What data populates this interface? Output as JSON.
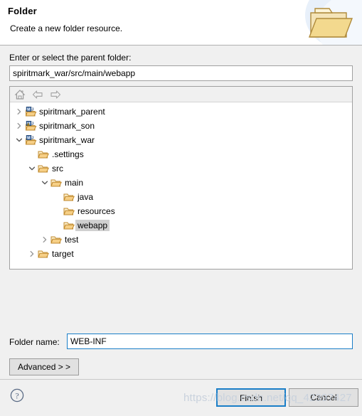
{
  "header": {
    "title": "Folder",
    "description": "Create a new folder resource.",
    "banner_icon": "open-folder-icon"
  },
  "form": {
    "parent_label": "Enter or select the parent folder:",
    "parent_value": "spiritmark_war/src/main/webapp",
    "parent_placeholder": "",
    "folder_name_label": "Folder name:",
    "folder_name_value": "WEB-INF",
    "folder_name_placeholder": "",
    "advanced_label": "Advanced  > >"
  },
  "tree_toolbar": {
    "home_icon": "home-icon",
    "back_icon": "back-arrow-icon",
    "forward_icon": "forward-arrow-icon"
  },
  "tree": {
    "items": [
      {
        "label": "spiritmark_parent",
        "indent": 0,
        "twisty": "collapsed",
        "icon": "maven-project-icon",
        "selected": false,
        "warning": false
      },
      {
        "label": "spiritmark_son",
        "indent": 0,
        "twisty": "collapsed",
        "icon": "maven-project-icon",
        "selected": false,
        "warning": true
      },
      {
        "label": "spiritmark_war",
        "indent": 0,
        "twisty": "expanded",
        "icon": "maven-project-icon",
        "selected": false,
        "warning": false
      },
      {
        "label": ".settings",
        "indent": 1,
        "twisty": "none",
        "icon": "folder-icon",
        "selected": false,
        "warning": false
      },
      {
        "label": "src",
        "indent": 1,
        "twisty": "expanded",
        "icon": "folder-icon",
        "selected": false,
        "warning": false
      },
      {
        "label": "main",
        "indent": 2,
        "twisty": "expanded",
        "icon": "folder-icon",
        "selected": false,
        "warning": false
      },
      {
        "label": "java",
        "indent": 3,
        "twisty": "none",
        "icon": "folder-icon",
        "selected": false,
        "warning": false
      },
      {
        "label": "resources",
        "indent": 3,
        "twisty": "none",
        "icon": "folder-icon",
        "selected": false,
        "warning": false
      },
      {
        "label": "webapp",
        "indent": 3,
        "twisty": "none",
        "icon": "folder-icon",
        "selected": true,
        "warning": false
      },
      {
        "label": "test",
        "indent": 2,
        "twisty": "collapsed",
        "icon": "folder-icon",
        "selected": false,
        "warning": false
      },
      {
        "label": "target",
        "indent": 1,
        "twisty": "collapsed",
        "icon": "folder-icon",
        "selected": false,
        "warning": false
      }
    ]
  },
  "footer": {
    "help_icon": "help-question-icon",
    "finish_label": "Finish",
    "cancel_label": "Cancel"
  },
  "watermark": {
    "text": "https://blog.csdn.net/qq_42397427"
  },
  "colors": {
    "accent": "#1a7ec8",
    "dialog_bg": "#f0f0f0",
    "header_bg": "#ffffff",
    "selection": "#d0d0d0",
    "folder_fill": "#f6d79a"
  }
}
